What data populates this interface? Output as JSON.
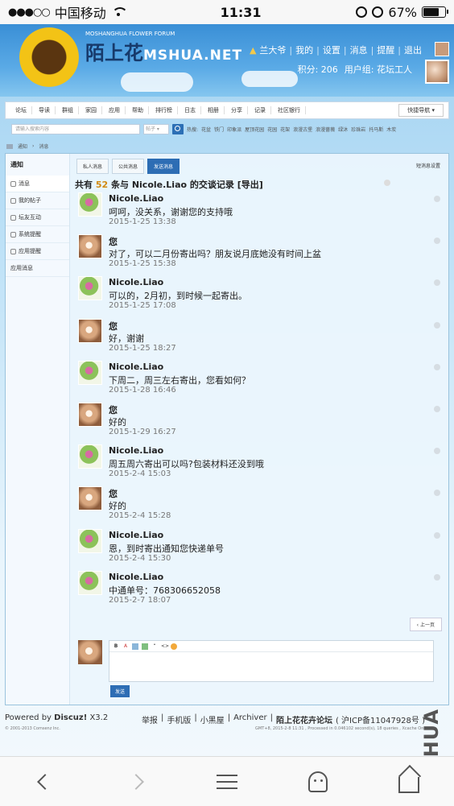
{
  "statusbar": {
    "carrier": "中国移动",
    "time": "11:31",
    "battery_pct": "67%",
    "battery_level": 0.67
  },
  "header": {
    "logo_cn": "陌上花",
    "logo_en": "MSHUA.NET",
    "logo_tagline": "MOSHANGHUA FLOWER FORUM",
    "user_nav": [
      "兰大爷",
      "我的",
      "设置",
      "消息",
      "提醒",
      "退出"
    ],
    "points_label": "积分: 206",
    "group_label": "用户组: 花坛工人"
  },
  "nav": {
    "items": [
      "论坛",
      "导读",
      "群组",
      "家园",
      "应用",
      "帮助",
      "排行榜",
      "日志",
      "相册",
      "分享",
      "记录",
      "社区银行"
    ],
    "quick_nav": "快捷导航"
  },
  "search": {
    "placeholder": "请输入搜索内容",
    "type": "帖子",
    "hot_label": "热搜:",
    "hot_terms": [
      "花盆",
      "铁门",
      "印象派",
      "屋顶花园",
      "花园",
      "花架",
      "浪漫古堡",
      "浪漫蔷薇",
      "绿沐",
      "珍珠岩",
      "托马斯",
      "木炭"
    ]
  },
  "breadcrumb": [
    "通知",
    "消息"
  ],
  "sidebar": {
    "title": "通知",
    "items": [
      "消息",
      "我的帖子",
      "坛友互动",
      "系统提醒",
      "应用提醒",
      "应用消息"
    ]
  },
  "tabs": [
    "私人消息",
    "公共消息",
    "发送消息"
  ],
  "settings_link": "短消息设置",
  "conversation": {
    "prefix": "共有",
    "count": "52",
    "suffix": "条与 Nicole.Liao 的交谈记录",
    "export": "[导出]"
  },
  "messages": [
    {
      "sender": "Nicole.Liao",
      "text": "呵呵，没关系，谢谢您的支持哦",
      "time": "2015-1-25 13:38",
      "avatar": "nicole"
    },
    {
      "sender": "您",
      "text": "对了，可以二月份寄出吗？朋友说月底她没有时间上盆",
      "time": "2015-1-25 15:38",
      "avatar": "me"
    },
    {
      "sender": "Nicole.Liao",
      "text": "可以的，2月初，到时候一起寄出。",
      "time": "2015-1-25 17:08",
      "avatar": "nicole"
    },
    {
      "sender": "您",
      "text": "好，谢谢",
      "time": "2015-1-25 18:27",
      "avatar": "me"
    },
    {
      "sender": "Nicole.Liao",
      "text": "下周二，周三左右寄出，您看如何？",
      "time": "2015-1-28 16:46",
      "avatar": "nicole"
    },
    {
      "sender": "您",
      "text": "好的",
      "time": "2015-1-29 16:27",
      "avatar": "me"
    },
    {
      "sender": "Nicole.Liao",
      "text": "周五周六寄出可以吗?包装材料还没到哦",
      "time": "2015-2-4 15:03",
      "avatar": "nicole"
    },
    {
      "sender": "您",
      "text": "好的",
      "time": "2015-2-4 15:28",
      "avatar": "me"
    },
    {
      "sender": "Nicole.Liao",
      "text": "恩，到时寄出通知您快递单号",
      "time": "2015-2-4 15:30",
      "avatar": "nicole"
    },
    {
      "sender": "Nicole.Liao",
      "text": "中通单号：768306652058",
      "time": "2015-2-7 18:07",
      "avatar": "nicole"
    }
  ],
  "prev_button": "上一页",
  "editor_toolbar": [
    "B",
    "A",
    "img",
    "pic",
    "quote",
    "code",
    "smile"
  ],
  "send_button": "发送",
  "footer": {
    "powered_prefix": "Powered by",
    "powered_brand": "Discuz!",
    "powered_version": "X3.2",
    "copyright": "© 2001-2013 Comsenz Inc.",
    "links": [
      "举报",
      "手机版",
      "小黑屋",
      "Archiver",
      "陌上花花卉论坛",
      "( 沪ICP备11047928号 )"
    ],
    "gmt": "GMT+8, 2015-2-8 11:31 , Processed in 0.046102 second(s), 18 queries , Xcache On."
  },
  "watermark": "MSHUA",
  "colors": {
    "accent": "#2d6db4",
    "count_highlight": "#d18a12"
  }
}
